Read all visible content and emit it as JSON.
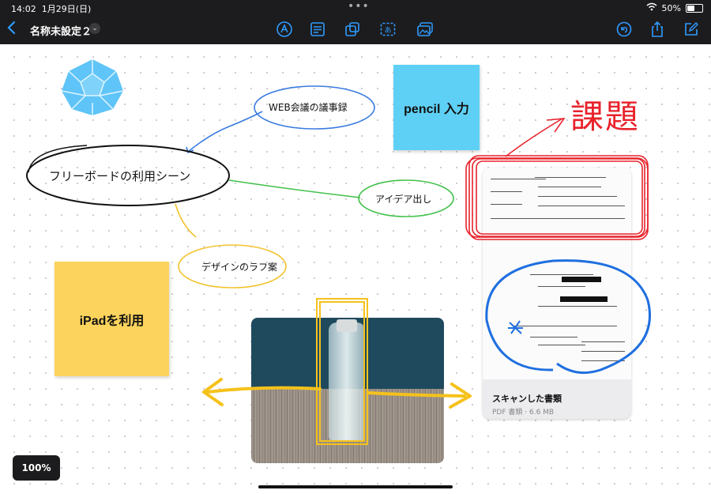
{
  "status": {
    "time": "14:02",
    "date": "1月29日(日)",
    "dots": "•••",
    "battery": "50%"
  },
  "nav": {
    "title": "名称未設定２"
  },
  "canvas": {
    "main_topic": "フリーボードの利用シーン",
    "bubble_web": "WEB会議の議事録",
    "bubble_idea": "アイデア出し",
    "bubble_design": "デザインのラフ案",
    "sticky_pencil": "pencil 入力",
    "sticky_ipad": "iPadを利用",
    "kadai": "課題"
  },
  "document": {
    "name": "スキャンした書類",
    "meta": "PDF 書類 · 6.6 MB"
  },
  "zoom": {
    "level": "100%"
  },
  "colors": {
    "accent": "#2f9bff",
    "sticky_blue": "#5fd0f5",
    "sticky_yellow": "#fcd35c"
  }
}
